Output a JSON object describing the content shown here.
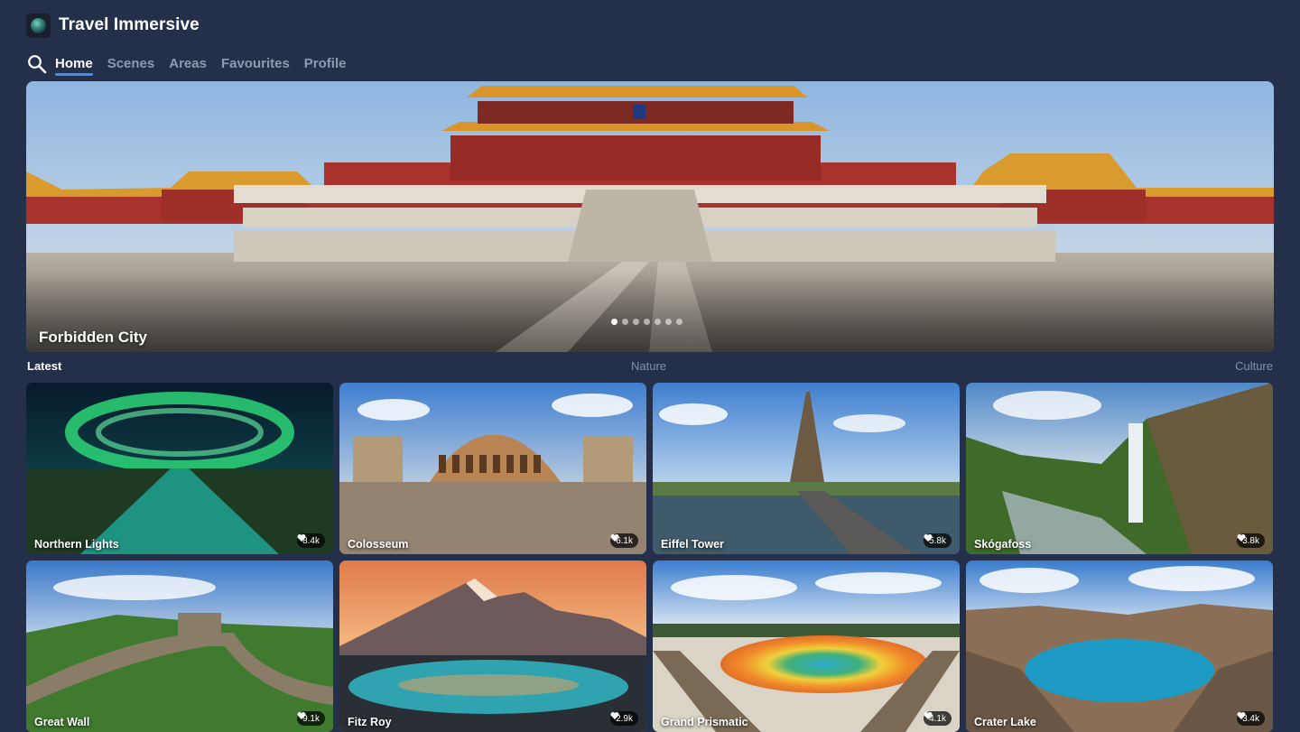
{
  "app": {
    "title": "Travel Immersive",
    "logo_icon": "globe-logo-icon"
  },
  "nav": {
    "search_icon": "search-icon",
    "tabs": [
      {
        "label": "Home",
        "active": true
      },
      {
        "label": "Scenes",
        "active": false
      },
      {
        "label": "Areas",
        "active": false
      },
      {
        "label": "Favourites",
        "active": false
      },
      {
        "label": "Profile",
        "active": false
      }
    ]
  },
  "hero": {
    "title": "Forbidden City",
    "slide_count": 7,
    "active_slide": 1
  },
  "sections": {
    "latest": "Latest",
    "nature": "Nature",
    "culture": "Culture"
  },
  "cards": [
    {
      "title": "Northern Lights",
      "likes": "8.4k"
    },
    {
      "title": "Colosseum",
      "likes": "6.1k"
    },
    {
      "title": "Eiffel Tower",
      "likes": "5.8k"
    },
    {
      "title": "Skógafoss",
      "likes": "3.8k"
    },
    {
      "title": "Great Wall",
      "likes": "9.1k"
    },
    {
      "title": "Fitz Roy",
      "likes": "2.9k"
    },
    {
      "title": "Grand Prismatic",
      "likes": "4.1k"
    },
    {
      "title": "Crater Lake",
      "likes": "3.4k"
    }
  ],
  "colors": {
    "background": "#243049",
    "accent": "#3f8ef5",
    "muted_text": "#8f9ab0"
  }
}
